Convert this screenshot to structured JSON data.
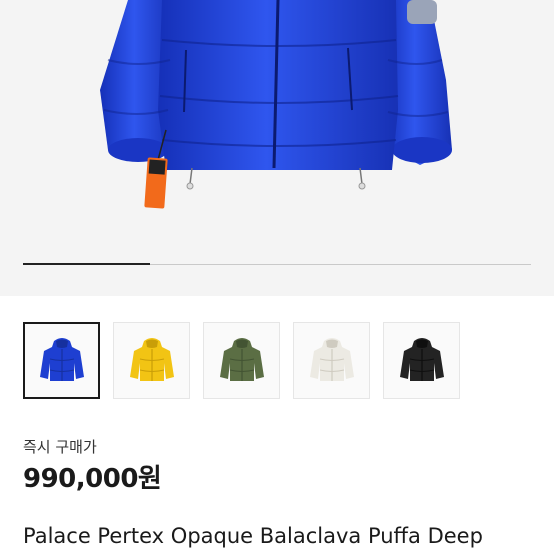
{
  "gallery": {
    "progress": 0.25,
    "thumbnails": [
      {
        "name": "thumbnail-blue",
        "color": "#1e3fd1",
        "shade": "#16309f",
        "selected": true
      },
      {
        "name": "thumbnail-yellow",
        "color": "#f2c414",
        "shade": "#c99e08",
        "selected": false
      },
      {
        "name": "thumbnail-olive",
        "color": "#5b6e44",
        "shade": "#435433",
        "selected": false
      },
      {
        "name": "thumbnail-white",
        "color": "#eceae3",
        "shade": "#cfcbc0",
        "selected": false
      },
      {
        "name": "thumbnail-black",
        "color": "#232323",
        "shade": "#0f0f0f",
        "selected": false
      }
    ]
  },
  "product": {
    "instant_buy_label": "즉시 구매가",
    "price": "990,000원",
    "title": "Palace Pertex Opaque Balaclava Puffa Deep"
  }
}
